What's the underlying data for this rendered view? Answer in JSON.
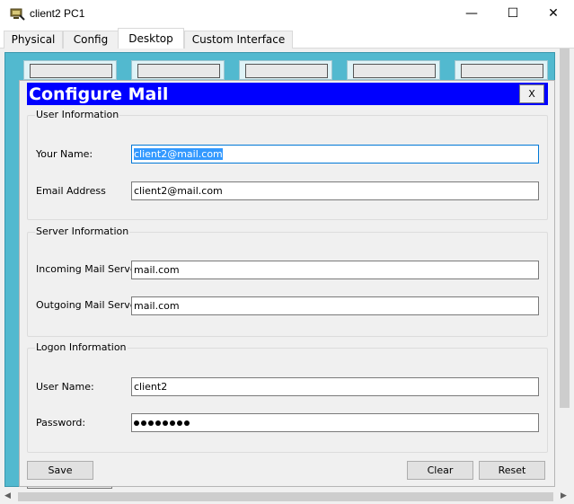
{
  "window": {
    "title": "client2 PC1",
    "minimize": "—",
    "maximize": "☐",
    "close": "✕"
  },
  "tabs": [
    {
      "label": "Physical",
      "active": false
    },
    {
      "label": "Config",
      "active": false
    },
    {
      "label": "Desktop",
      "active": true
    },
    {
      "label": "Custom Interface",
      "active": false
    }
  ],
  "dialog": {
    "title": "Configure Mail",
    "close_label": "X",
    "header_color": "#0000ff",
    "user_info": {
      "title": "User Information",
      "your_name_label": "Your Name:",
      "your_name_value": "client2@mail.com",
      "email_label": "Email Address",
      "email_value": "client2@mail.com"
    },
    "server_info": {
      "title": "Server Information",
      "incoming_label": "Incoming Mail Server",
      "incoming_value": "mail.com",
      "outgoing_label": "Outgoing Mail Server",
      "outgoing_value": "mail.com"
    },
    "logon_info": {
      "title": "Logon Information",
      "username_label": "User Name:",
      "username_value": "client2",
      "password_label": "Password:",
      "password_length": 8
    },
    "buttons": {
      "save": "Save",
      "clear": "Clear",
      "reset": "Reset"
    }
  },
  "colors": {
    "desktop_background": "#52b9cf",
    "selection": "#3399ff"
  }
}
